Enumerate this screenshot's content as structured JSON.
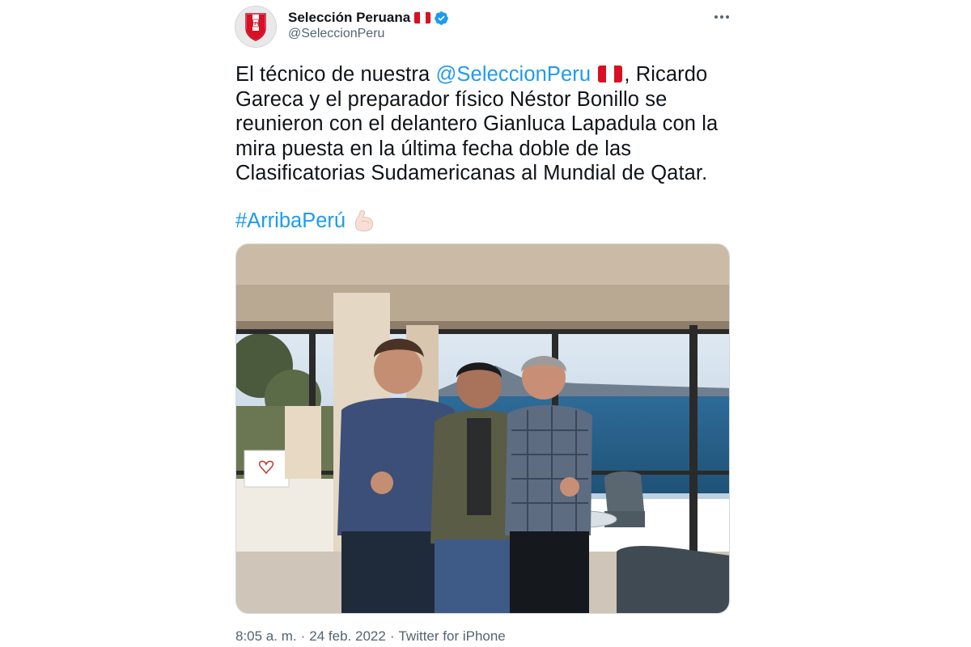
{
  "author": {
    "display_name": "Selección Peruana",
    "handle": "@SeleccionPeru",
    "verified": true,
    "avatar_icon": "fpf-crest-icon"
  },
  "tweet": {
    "text_pre": "El técnico de nuestra ",
    "mention": "@SeleccionPeru",
    "text_post": ", Ricardo Gareca y el preparador físico Néstor Bonillo se reunieron con el delantero Gianluca Lapadula con la mira puesta en la última fecha doble de las Clasificatorias Sudamericanas al Mundial de Qatar.",
    "hashtag": "#ArribaPerú",
    "emoji_icon": "flexed-biceps-icon"
  },
  "media": {
    "type": "photo",
    "description_icon": "photo-three-men-hotel-room"
  },
  "meta": {
    "time": "8:05 a. m.",
    "separator": "·",
    "date": "24 feb. 2022",
    "source": "Twitter for iPhone"
  },
  "colors": {
    "link": "#1d9bf0",
    "text": "#0f1419",
    "muted": "#536471",
    "flag_red": "#d91023"
  }
}
